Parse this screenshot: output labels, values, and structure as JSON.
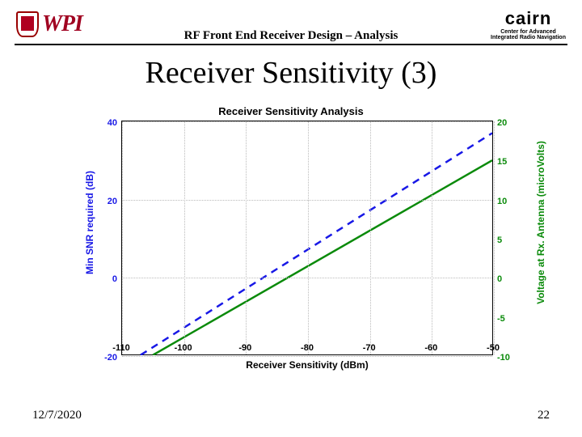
{
  "header": {
    "left_logo_text": "WPI",
    "title": "RF Front End Receiver Design – Analysis",
    "right_logo_text": "cairn",
    "right_logo_sub1": "Center for Advanced",
    "right_logo_sub2": "Integrated Radio Navigation"
  },
  "slide_title": "Receiver Sensitivity (3)",
  "footer": {
    "date": "12/7/2020",
    "page": "22"
  },
  "chart_data": {
    "type": "line",
    "title": "Receiver Sensitivity Analysis",
    "xlabel": "Receiver Sensitivity (dBm)",
    "ylabel_left": "Min SNR required (dB)",
    "ylabel_right": "Voltage at Rx. Antenna (microVolts)",
    "xlim": [
      -110,
      -50
    ],
    "ylim_left": [
      -20,
      40
    ],
    "ylim_right": [
      -10,
      20
    ],
    "xticks": [
      -110,
      -100,
      -90,
      -80,
      -70,
      -60,
      -50
    ],
    "yticks_left": [
      -20,
      0,
      20,
      40
    ],
    "yticks_right": [
      -10,
      -5,
      0,
      5,
      10,
      15,
      20
    ],
    "series": [
      {
        "name": "Min SNR required",
        "axis": "left",
        "style": "dashed",
        "color": "#1818e6",
        "x": [
          -107,
          -50
        ],
        "y": [
          -20,
          37
        ]
      },
      {
        "name": "Voltage at Rx. Antenna",
        "axis": "right",
        "style": "solid",
        "color": "#0a8a0a",
        "x": [
          -105,
          -50
        ],
        "y": [
          -10,
          15
        ]
      }
    ]
  }
}
